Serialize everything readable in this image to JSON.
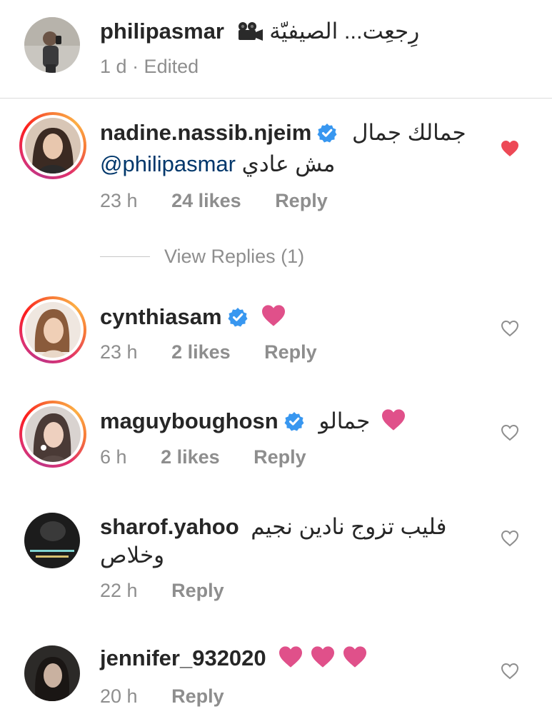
{
  "caption": {
    "username": "philipasmar",
    "emoji": "video-camera-icon",
    "text": "رِجعِت... الصيفيّة",
    "time": "1 d",
    "edited": "· Edited"
  },
  "comments": [
    {
      "username": "nadine.nassib.njeim",
      "verified": true,
      "text": "جمالك جمال",
      "mention": "@philipasmar",
      "text2": "مش عادي",
      "time": "23 h",
      "likes": "24 likes",
      "reply": "Reply",
      "liked": true
    },
    {
      "username": "cynthiasam",
      "verified": true,
      "time": "23 h",
      "likes": "2 likes",
      "reply": "Reply",
      "liked": false
    },
    {
      "username": "maguyboughosn",
      "verified": true,
      "text": "جمالو",
      "time": "6 h",
      "likes": "2 likes",
      "reply": "Reply",
      "liked": false
    },
    {
      "username": "sharof.yahoo",
      "verified": false,
      "text": "فليب تزوج نادين نجيم",
      "text2": "وخلاص",
      "time": "22 h",
      "reply": "Reply",
      "liked": false
    },
    {
      "username": "jennifer_932020",
      "verified": false,
      "time": "20 h",
      "reply": "Reply",
      "liked": false
    }
  ],
  "view_replies": "View Replies (1)",
  "colors": {
    "heart_pink": "#e0508a",
    "liked_red": "#ed4956",
    "verified_blue": "#3897f0",
    "meta_gray": "#8e8e8e",
    "mention_blue": "#00376b"
  }
}
